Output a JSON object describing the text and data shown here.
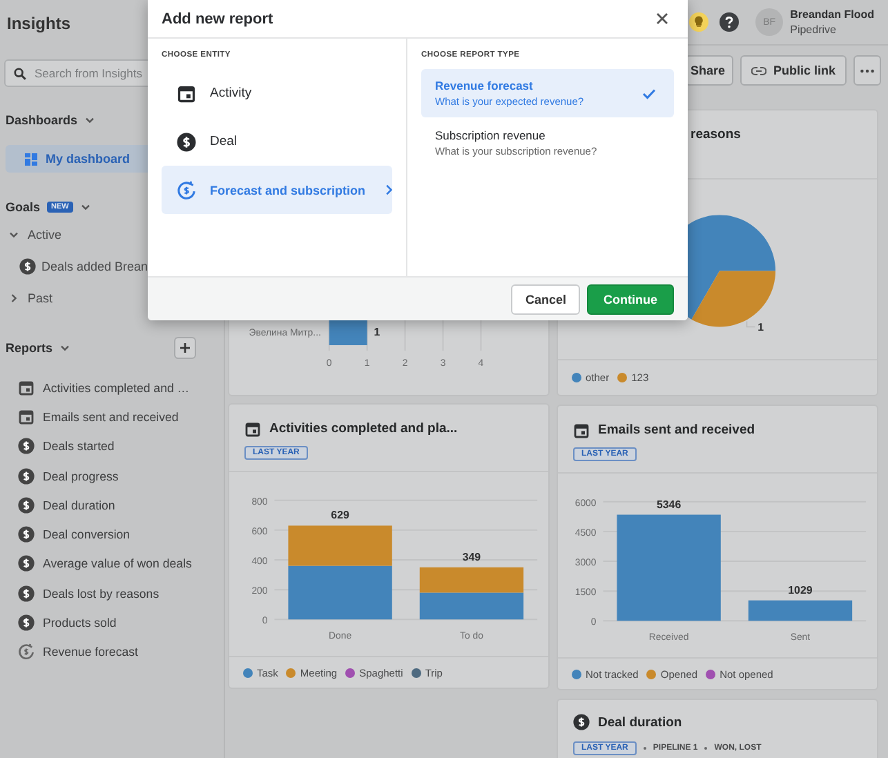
{
  "header": {
    "title": "Insights",
    "user": {
      "initials": "BF",
      "name": "Breandan Flood",
      "company": "Pipedrive"
    }
  },
  "sidebar": {
    "search": {
      "placeholder": "Search from Insights"
    },
    "dashboards": {
      "label": "Dashboards",
      "expanded": true,
      "items": [
        {
          "label": "My dashboard",
          "selected": true
        }
      ]
    },
    "goals": {
      "label": "Goals",
      "badge": "NEW",
      "expanded": true,
      "groups": [
        {
          "label": "Active",
          "expanded": true,
          "children": [
            {
              "label": "Deals added Brean",
              "kind": "deal"
            }
          ]
        },
        {
          "label": "Past",
          "expanded": false
        }
      ]
    },
    "reports": {
      "label": "Reports",
      "expanded": true,
      "items": [
        {
          "label": "Activities completed and …",
          "kind": "activity"
        },
        {
          "label": "Emails sent and received",
          "kind": "activity"
        },
        {
          "label": "Deals started",
          "kind": "deal"
        },
        {
          "label": "Deal progress",
          "kind": "deal"
        },
        {
          "label": "Deal duration",
          "kind": "deal"
        },
        {
          "label": "Deal conversion",
          "kind": "deal"
        },
        {
          "label": "Average value of won deals",
          "kind": "deal"
        },
        {
          "label": "Deals lost by reasons",
          "kind": "deal"
        },
        {
          "label": "Products sold",
          "kind": "deal"
        },
        {
          "label": "Revenue forecast",
          "kind": "forecast"
        }
      ]
    }
  },
  "toolbar": {
    "buttons": [
      {
        "label": "Share",
        "kind": "plain"
      },
      {
        "label": "Public link",
        "kind": "link"
      },
      {
        "kind": "more"
      }
    ]
  },
  "columns": [
    {
      "cards": [
        {
          "kind": "hbar",
          "chart_data": {
            "type": "bar",
            "orientation": "horizontal",
            "categories": [
              "Эвелина Митр..."
            ],
            "series": [
              {
                "color": "#4384ba",
                "values": [
                  1
                ]
              }
            ],
            "xlim": [
              0,
              4
            ],
            "xticks": [
              0,
              1,
              2,
              3,
              4
            ],
            "grid": true,
            "data_labels": true
          }
        },
        {
          "kind": "activity_chart",
          "title": "Activities completed and pla...",
          "badges": [
            "LAST YEAR"
          ],
          "chart_data": {
            "type": "bar",
            "stacked": true,
            "categories": [
              "Done",
              "To do"
            ],
            "series": [
              {
                "name": "Task",
                "color": "#4384ba",
                "values": [
                  360,
                  180
                ]
              },
              {
                "name": "Meeting",
                "color": "#c98a2c",
                "values": [
                  270,
                  170
                ]
              },
              {
                "name": "Spaghetti",
                "color": "#a050b0",
                "values": [
                  0,
                  0
                ]
              },
              {
                "name": "Trip",
                "color": "#4e6a80",
                "values": [
                  0,
                  0
                ]
              }
            ],
            "ylim": [
              0,
              800
            ],
            "yticks": [
              0,
              200,
              400,
              600,
              800
            ],
            "grid": true,
            "value_labels": [
              "629",
              "349"
            ]
          }
        }
      ]
    },
    {
      "cards": [
        {
          "kind": "pie",
          "title": "reasons",
          "pie_label": "1",
          "legend": [
            {
              "label": "other",
              "color": "#4384ba"
            },
            {
              "label": "123",
              "color": "#c98a2c"
            }
          ]
        },
        {
          "kind": "activity_chart",
          "title": "Emails sent and received",
          "badges": [
            "LAST YEAR"
          ],
          "chart_data": {
            "type": "bar",
            "stacked": true,
            "categories": [
              "Received",
              "Sent"
            ],
            "series": [
              {
                "name": "Not tracked",
                "color": "#4384ba",
                "values": [
                  5346,
                  1029
                ]
              },
              {
                "name": "Opened",
                "color": "#c98a2c",
                "values": [
                  0,
                  0
                ]
              },
              {
                "name": "Not opened",
                "color": "#a050b0",
                "values": [
                  0,
                  0
                ]
              }
            ],
            "ylim": [
              0,
              6000
            ],
            "yticks": [
              0,
              1500,
              3000,
              4500,
              6000
            ],
            "grid": true,
            "value_labels": [
              "5346",
              "1029"
            ]
          }
        },
        {
          "kind": "deal_summary",
          "title": "Deal duration",
          "badges": [
            "LAST YEAR"
          ],
          "filters": [
            "PIPELINE 1",
            "WON, LOST"
          ]
        }
      ]
    }
  ],
  "modal": {
    "title": "Add new report",
    "entity_heading": "CHOOSE ENTITY",
    "entities": [
      {
        "label": "Activity",
        "kind": "activity",
        "selected": false
      },
      {
        "label": "Deal",
        "kind": "deal",
        "selected": false
      },
      {
        "label": "Forecast and subscription",
        "kind": "forecast",
        "selected": true
      }
    ],
    "type_heading": "CHOOSE REPORT TYPE",
    "types": [
      {
        "title": "Revenue forecast",
        "description": "What is your expected revenue?",
        "selected": true
      },
      {
        "title": "Subscription revenue",
        "description": "What is your subscription revenue?",
        "selected": false
      }
    ],
    "buttons": [
      {
        "label": "Cancel",
        "kind": "secondary"
      },
      {
        "label": "Continue",
        "kind": "primary"
      }
    ]
  }
}
